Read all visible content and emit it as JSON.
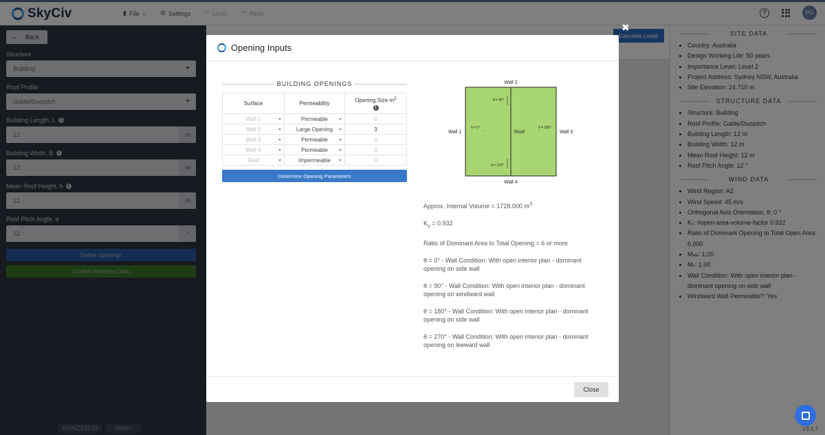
{
  "app": {
    "name": "SkyCiv",
    "avatar_initials": "PG",
    "version": "V3.5.7"
  },
  "menu": {
    "file": "File",
    "settings": "Settings",
    "undo": "Undo",
    "redo": "Redo"
  },
  "sidebar": {
    "back": "Back",
    "structure_label": "Structure",
    "structure_value": "Building",
    "roof_profile_label": "Roof Profile",
    "roof_profile_value": "Gable/Duopitch",
    "length_label": "Building Length, L",
    "length_value": "12",
    "width_label": "Building Width, B",
    "width_value": "12",
    "height_label": "Mean Roof Height, h",
    "height_value": "12",
    "pitch_label": "Roof Pitch Angle, α",
    "pitch_value": "12",
    "unit_m": "m",
    "unit_deg": "°",
    "define_openings": "Define Openings",
    "confirm_structure": "Confirm Structure Data",
    "standard": "AS/NZS1170",
    "units": "Metric"
  },
  "center": {
    "calculate_loads": "Calculate Loads"
  },
  "right_panel": {
    "site_heading": "SITE DATA",
    "site": [
      "Country: Australia",
      "Design Working Life: 50 years",
      "Importance Level: Level 2",
      "Project Address: Sydney NSW, Australia",
      "Site Elevation: 24.710 m"
    ],
    "structure_heading": "STRUCTURE DATA",
    "structure": [
      "Structure: Building",
      "Roof Profile: Gable/Duopitch",
      "Building Length: 12 m",
      "Building Width: 12 m",
      "Mean Roof Height: 12 m",
      "Roof Pitch Angle: 12 °"
    ],
    "wind_heading": "WIND DATA",
    "wind": [
      "Wind Region: A2",
      "Wind Speed: 45 m/s",
      "Orthogonal Axis Orientation, θ: 0 °",
      "Kᵥ: #open-area-volume-factor 0.932",
      "Ratio of Dominant Opening to Total Open Area: 6.000",
      "Mₗₑₑ: 1.00",
      "Mₛ: 1.00",
      "Wall Condition: With open interior plan - dominant opening on side wall",
      "Windward Wall Permeable?: Yes"
    ]
  },
  "modal": {
    "title": "Opening Inputs",
    "openings_heading": "BUILDING OPENINGS",
    "col_surface": "Surface",
    "col_permeability": "Permeability",
    "col_size": "Opening Size m",
    "col_size_sup": "2",
    "rows": [
      {
        "surface": "Wall 1",
        "permeability": "Permeable",
        "size": "0"
      },
      {
        "surface": "Wall 2",
        "permeability": "Large Opening",
        "size": "3"
      },
      {
        "surface": "Wall 3",
        "permeability": "Permeable",
        "size": "0"
      },
      {
        "surface": "Wall 4",
        "permeability": "Permeable",
        "size": "0"
      },
      {
        "surface": "Roof",
        "permeability": "Impermeable",
        "size": "0"
      }
    ],
    "determine_button": "Determine Opening Parameters",
    "diagram": {
      "wall1": "Wall 1",
      "wall2": "Wall 2",
      "wall3": "Wall 3",
      "wall4": "Wall 4",
      "roof": "Roof",
      "t0": "θ = 0°",
      "t90": "θ = 90°",
      "t180": "θ = 180°",
      "t270": "θ = 270°",
      "fill_color": "#a8d672"
    },
    "results": {
      "volume": "Approx. Internal Volume = 1728.000 m",
      "volume_sup": "3",
      "kv_k": "K",
      "kv_sub": "v",
      "kv_val": " = 0.932",
      "ratio": "Ratio of Dominant Area to Total Opening = 6 or more",
      "c0": "θ = 0° - Wall Condition: With open interior plan - dominant opening on side wall",
      "c90": "θ = 90° - Wall Condition: With open interior plan - dominant opening on windward wall",
      "c180": "θ = 180° - Wall Condition: With open interior plan - dominant opening on side wall",
      "c270": "θ = 270° - Wall Condition: With open interior plan - dominant opening on leeward wall"
    },
    "close": "Close"
  }
}
